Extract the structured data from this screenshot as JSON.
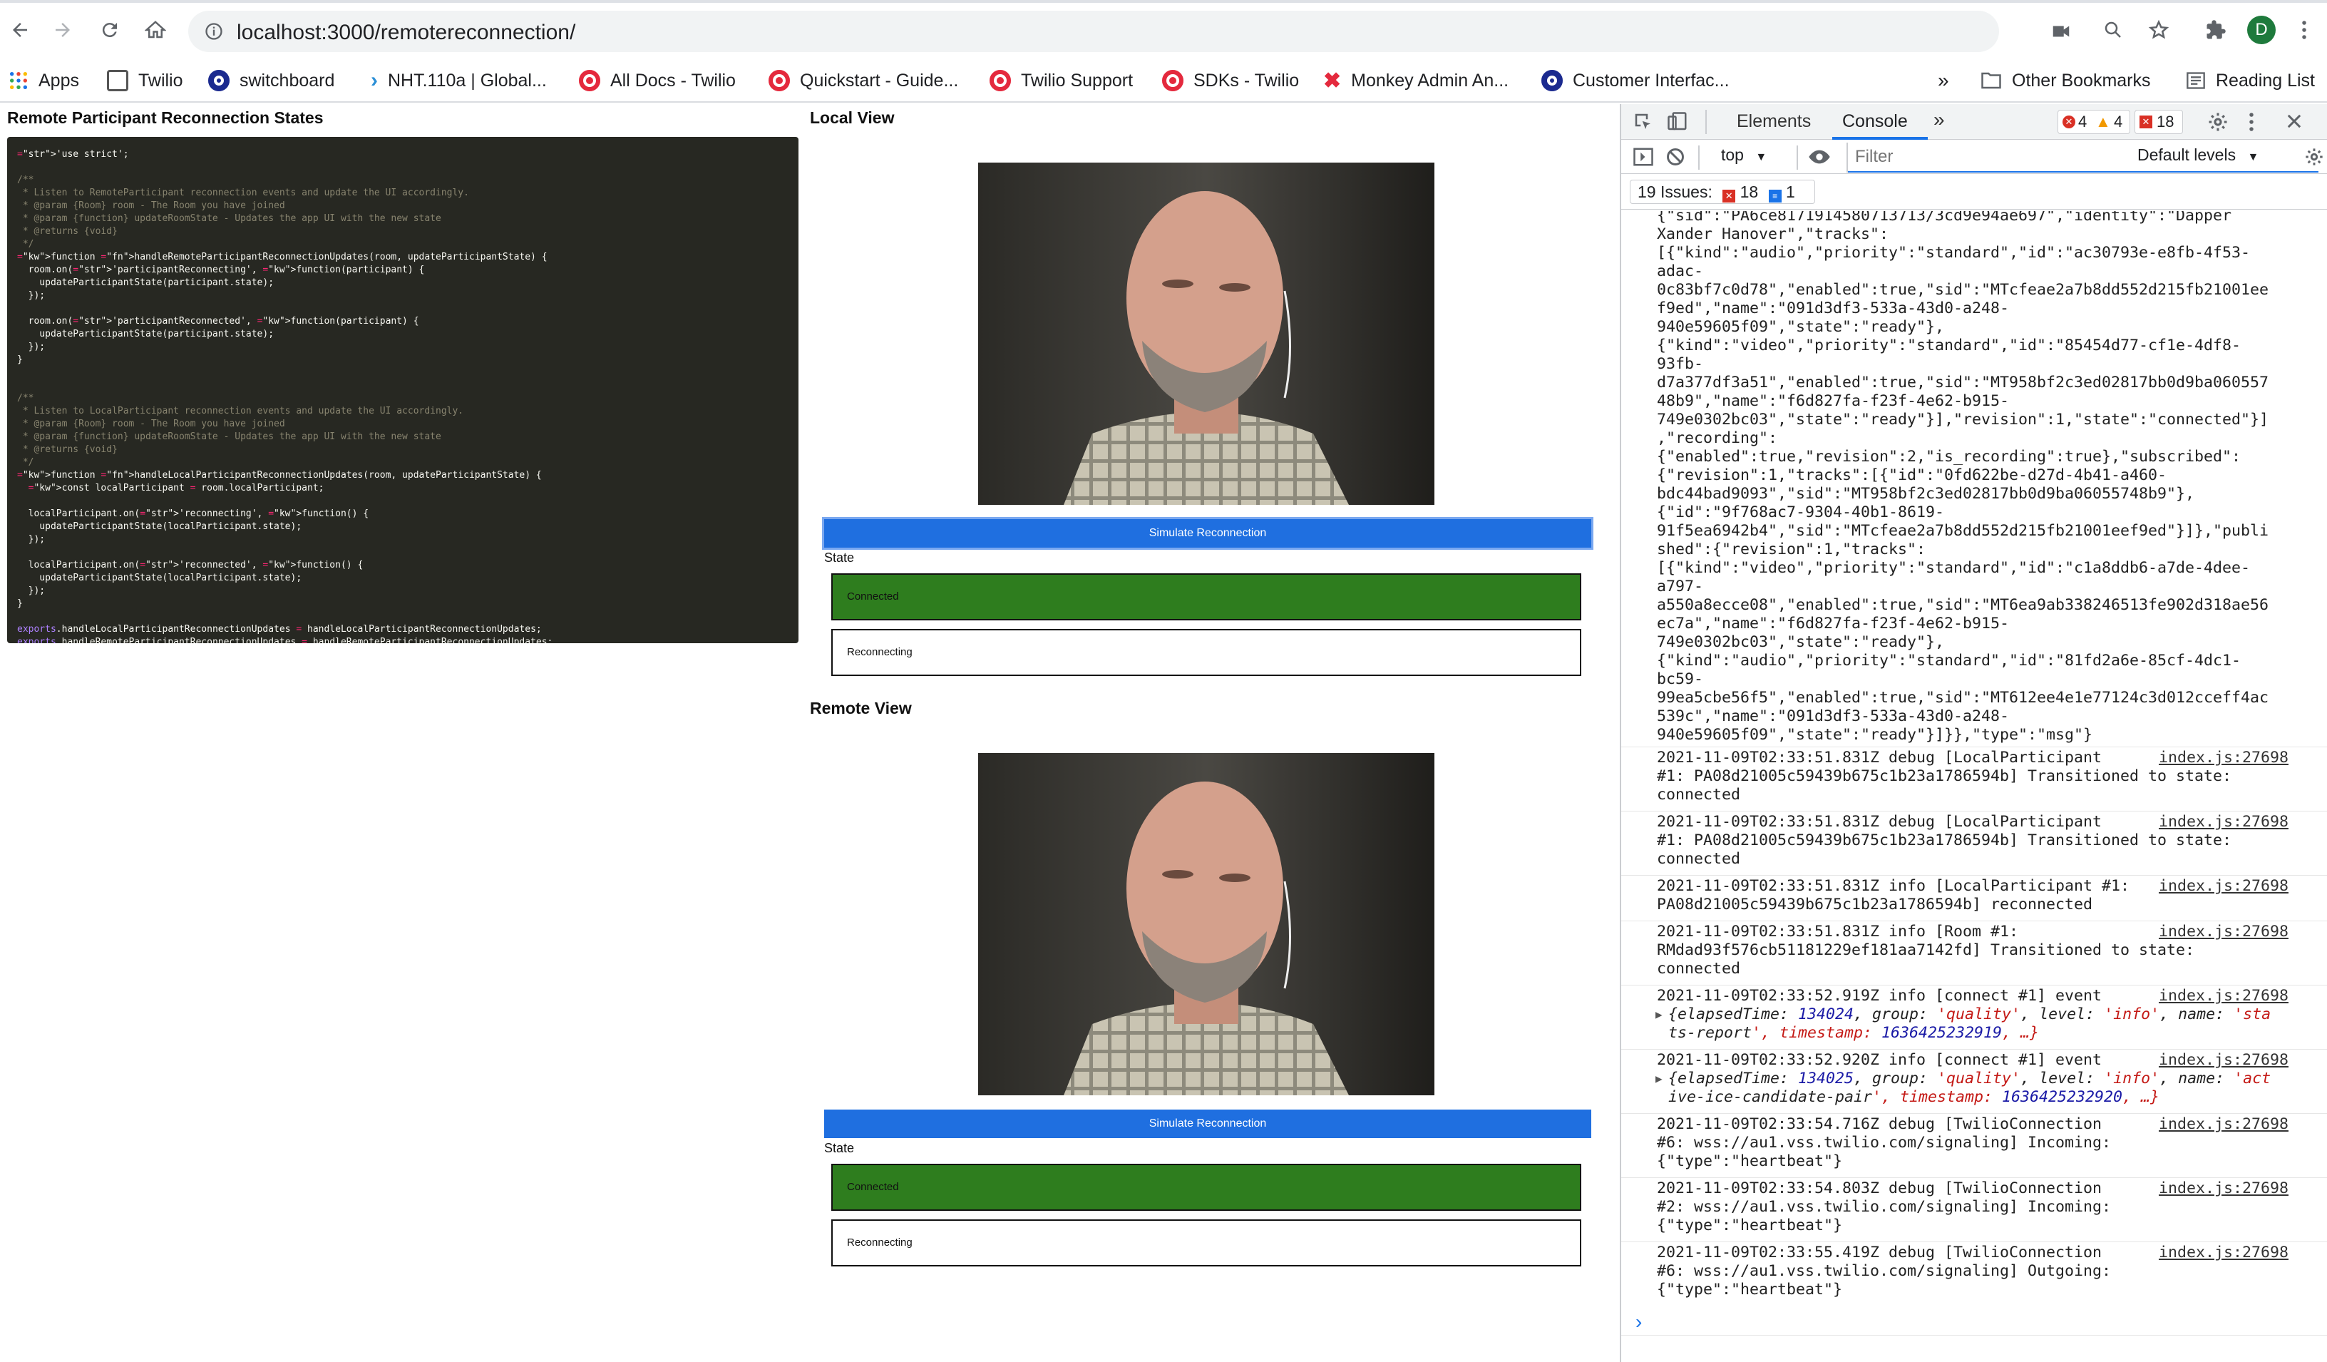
{
  "browser": {
    "url": "localhost:3000/remotereconnection/",
    "profile_initial": "D",
    "bookmarks": [
      "Apps",
      "Twilio",
      "switchboard",
      "NHT.110a | Global...",
      "All Docs - Twilio",
      "Quickstart - Guide...",
      "Twilio Support",
      "SDKs - Twilio",
      "Monkey Admin An...",
      "Customer Interfac..."
    ],
    "more_bookmarks": "»",
    "other_bookmarks": "Other Bookmarks",
    "reading_list": "Reading List"
  },
  "page": {
    "remote_heading": "Remote Participant Reconnection States",
    "local_heading": "Local View",
    "remote_view_heading": "Remote View",
    "local": {
      "button": "Simulate Reconnection",
      "state_label": "State",
      "state_connected": "Connected",
      "state_reconnecting": "Reconnecting"
    },
    "remote": {
      "button": "Simulate Reconnection",
      "state_label": "State",
      "state_connected": "Connected",
      "state_reconnecting": "Reconnecting"
    },
    "colors": {
      "connected_fill": "#2e7d1e",
      "button_blue": "#1f6fe0"
    }
  },
  "devtools": {
    "tabs": [
      "Elements",
      "Console"
    ],
    "active_tab": "Console",
    "more_tabs": "»",
    "errors": "4",
    "warnings": "4",
    "issues_count": "18",
    "context": "top",
    "filter_placeholder": "Filter",
    "levels": "Default levels",
    "issues_label": "19 Issues:",
    "issues_errors": "18",
    "issues_info": "1",
    "prompt": "›"
  },
  "console": {
    "json_block": [
      "{\"sid\":\"PA6ce8171914580713713/3cd9e94ae697\",\"identity\":\"Dapper",
      "Xander Hanover\",\"tracks\":",
      "[{\"kind\":\"audio\",\"priority\":\"standard\",\"id\":\"ac30793e-e8fb-4f53-",
      "adac-",
      "0c83bf7c0d78\",\"enabled\":true,\"sid\":\"MTcfeae2a7b8dd552d215fb21001ee",
      "f9ed\",\"name\":\"091d3df3-533a-43d0-a248-",
      "940e59605f09\",\"state\":\"ready\"},",
      "{\"kind\":\"video\",\"priority\":\"standard\",\"id\":\"85454d77-cf1e-4df8-",
      "93fb-",
      "d7a377df3a51\",\"enabled\":true,\"sid\":\"MT958bf2c3ed02817bb0d9ba060557",
      "48b9\",\"name\":\"f6d827fa-f23f-4e62-b915-",
      "749e0302bc03\",\"state\":\"ready\"}],\"revision\":1,\"state\":\"connected\"}]",
      ",\"recording\":",
      "{\"enabled\":true,\"revision\":2,\"is_recording\":true},\"subscribed\":",
      "{\"revision\":1,\"tracks\":[{\"id\":\"0fd622be-d27d-4b41-a460-",
      "bdc44bad9093\",\"sid\":\"MT958bf2c3ed02817bb0d9ba06055748b9\"},",
      "{\"id\":\"9f768ac7-9304-40b1-8619-",
      "91f5ea6942b4\",\"sid\":\"MTcfeae2a7b8dd552d215fb21001eef9ed\"}]},\"publi",
      "shed\":{\"revision\":1,\"tracks\":",
      "[{\"kind\":\"video\",\"priority\":\"standard\",\"id\":\"c1a8ddb6-a7de-4dee-",
      "a797-",
      "a550a8ecce08\",\"enabled\":true,\"sid\":\"MT6ea9ab338246513fe902d318ae56",
      "ec7a\",\"name\":\"f6d827fa-f23f-4e62-b915-",
      "749e0302bc03\",\"state\":\"ready\"},",
      "{\"kind\":\"audio\",\"priority\":\"standard\",\"id\":\"81fd2a6e-85cf-4dc1-",
      "bc59-",
      "99ea5cbe56f5\",\"enabled\":true,\"sid\":\"MT612ee4e1e77124c3d012cceff4ac",
      "539c\",\"name\":\"091d3df3-533a-43d0-a248-",
      "940e59605f09\",\"state\":\"ready\"}]}},\"type\":\"msg\"}"
    ],
    "source": "index.js:27698",
    "entries": [
      {
        "lines": [
          "2021-11-09T02:33:51.831Z debug [LocalParticipant",
          "#1: PA08d21005c59439b675c1b23a1786594b] Transitioned to state:",
          "connected"
        ]
      },
      {
        "lines": [
          "2021-11-09T02:33:51.831Z debug [LocalParticipant",
          "#1: PA08d21005c59439b675c1b23a1786594b] Transitioned to state:",
          "connected"
        ]
      },
      {
        "lines": [
          "2021-11-09T02:33:51.831Z info [LocalParticipant #1:",
          "PA08d21005c59439b675c1b23a1786594b] reconnected"
        ]
      },
      {
        "lines": [
          "2021-11-09T02:33:51.831Z info [Room #1:",
          "RMdad93f576cb51181229ef181aa7142fd] Transitioned to state:",
          "connected"
        ]
      },
      {
        "lines": [
          "2021-11-09T02:33:52.919Z info [connect #1] event"
        ],
        "obj": [
          "{elapsedTime: 134024, group: 'quality', level: 'info', name: 'sta",
          "ts-report', timestamp: 1636425232919, …}"
        ]
      },
      {
        "lines": [
          "2021-11-09T02:33:52.920Z info [connect #1] event"
        ],
        "obj": [
          "{elapsedTime: 134025, group: 'quality', level: 'info', name: 'act",
          "ive-ice-candidate-pair', timestamp: 1636425232920, …}"
        ]
      },
      {
        "lines": [
          "2021-11-09T02:33:54.716Z debug [TwilioConnection",
          "#6: wss://au1.vss.twilio.com/signaling] Incoming:",
          "{\"type\":\"heartbeat\"}"
        ]
      },
      {
        "lines": [
          "2021-11-09T02:33:54.803Z debug [TwilioConnection",
          "#2: wss://au1.vss.twilio.com/signaling] Incoming:",
          "{\"type\":\"heartbeat\"}"
        ]
      },
      {
        "lines": [
          "2021-11-09T02:33:55.419Z debug [TwilioConnection",
          "#6: wss://au1.vss.twilio.com/signaling] Outgoing:",
          "{\"type\":\"heartbeat\"}"
        ]
      }
    ]
  },
  "code": {
    "lines": [
      "'use strict';",
      "",
      "/**",
      " * Listen to RemoteParticipant reconnection events and update the UI accordingly.",
      " * @param {Room} room - The Room you have joined",
      " * @param {function} updateRoomState - Updates the app UI with the new state",
      " * @returns {void}",
      " */",
      "function handleRemoteParticipantReconnectionUpdates(room, updateParticipantState) {",
      "  room.on('participantReconnecting', function(participant) {",
      "    updateParticipantState(participant.state);",
      "  });",
      "",
      "  room.on('participantReconnected', function(participant) {",
      "    updateParticipantState(participant.state);",
      "  });",
      "}",
      "",
      "",
      "/**",
      " * Listen to LocalParticipant reconnection events and update the UI accordingly.",
      " * @param {Room} room - The Room you have joined",
      " * @param {function} updateRoomState - Updates the app UI with the new state",
      " * @returns {void}",
      " */",
      "function handleLocalParticipantReconnectionUpdates(room, updateParticipantState) {",
      "  const localParticipant = room.localParticipant;",
      "",
      "  localParticipant.on('reconnecting', function() {",
      "    updateParticipantState(localParticipant.state);",
      "  });",
      "",
      "  localParticipant.on('reconnected', function() {",
      "    updateParticipantState(localParticipant.state);",
      "  });",
      "}",
      "",
      "exports.handleLocalParticipantReconnectionUpdates = handleLocalParticipantReconnectionUpdates;",
      "exports.handleRemoteParticipantReconnectionUpdates = handleRemoteParticipantReconnectionUpdates;"
    ]
  }
}
